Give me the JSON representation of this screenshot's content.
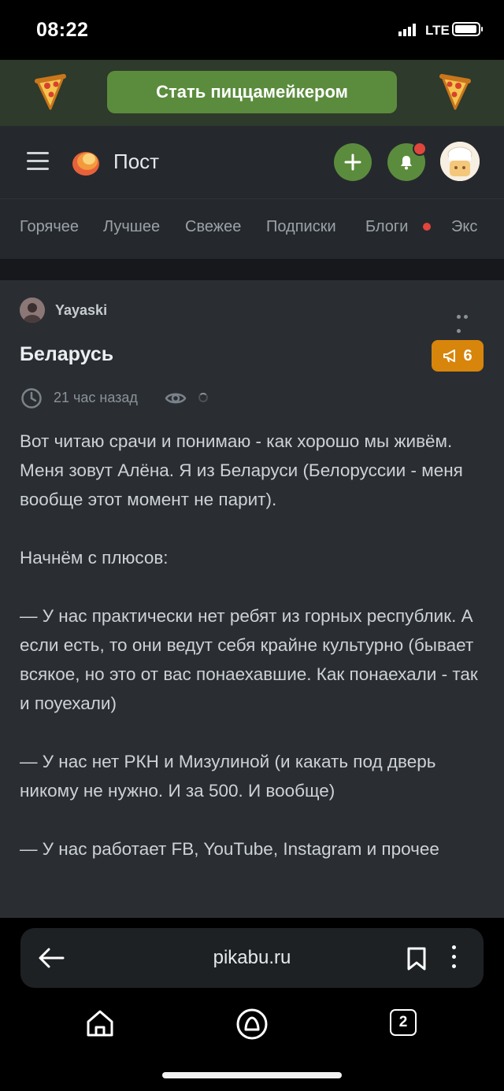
{
  "status_bar": {
    "time": "08:22",
    "network": "LTE"
  },
  "promo": {
    "cta_label": "Стать пиццамейкером"
  },
  "header": {
    "title": "Пост"
  },
  "tabs": [
    {
      "label": "Горячее"
    },
    {
      "label": "Лучшее"
    },
    {
      "label": "Свежее"
    },
    {
      "label": "Подписки"
    },
    {
      "label": "Блоги"
    },
    {
      "label": "Экс"
    }
  ],
  "post": {
    "author": "Yayaski",
    "title": "Беларусь",
    "rating": "6",
    "time_ago": "21 час назад",
    "paragraphs": [
      "Вот читаю срачи и понимаю - как хорошо мы живём. Меня зовут Алёна. Я из Беларуси (Белоруссии - меня вообще этот момент не парит).",
      "Начнём с плюсов:",
      "— У нас практически нет ребят из горных республик. А если есть, то они ведут себя крайне культурно (бывает всякое, но это от вас понаехавшие. Как понаехали - так и поуехали)",
      "— У нас нет РКН и Мизулиной (и какать под дверь никому не нужно. И за 500. И вообще)",
      "— У нас работает FB, YouTube, Instagram и прочее"
    ]
  },
  "browser": {
    "url": "pikabu.ru",
    "tab_count": "2"
  },
  "colors": {
    "accent_green": "#5b8c3d",
    "rating_orange": "#d8850b",
    "notification_red": "#e2453c"
  }
}
